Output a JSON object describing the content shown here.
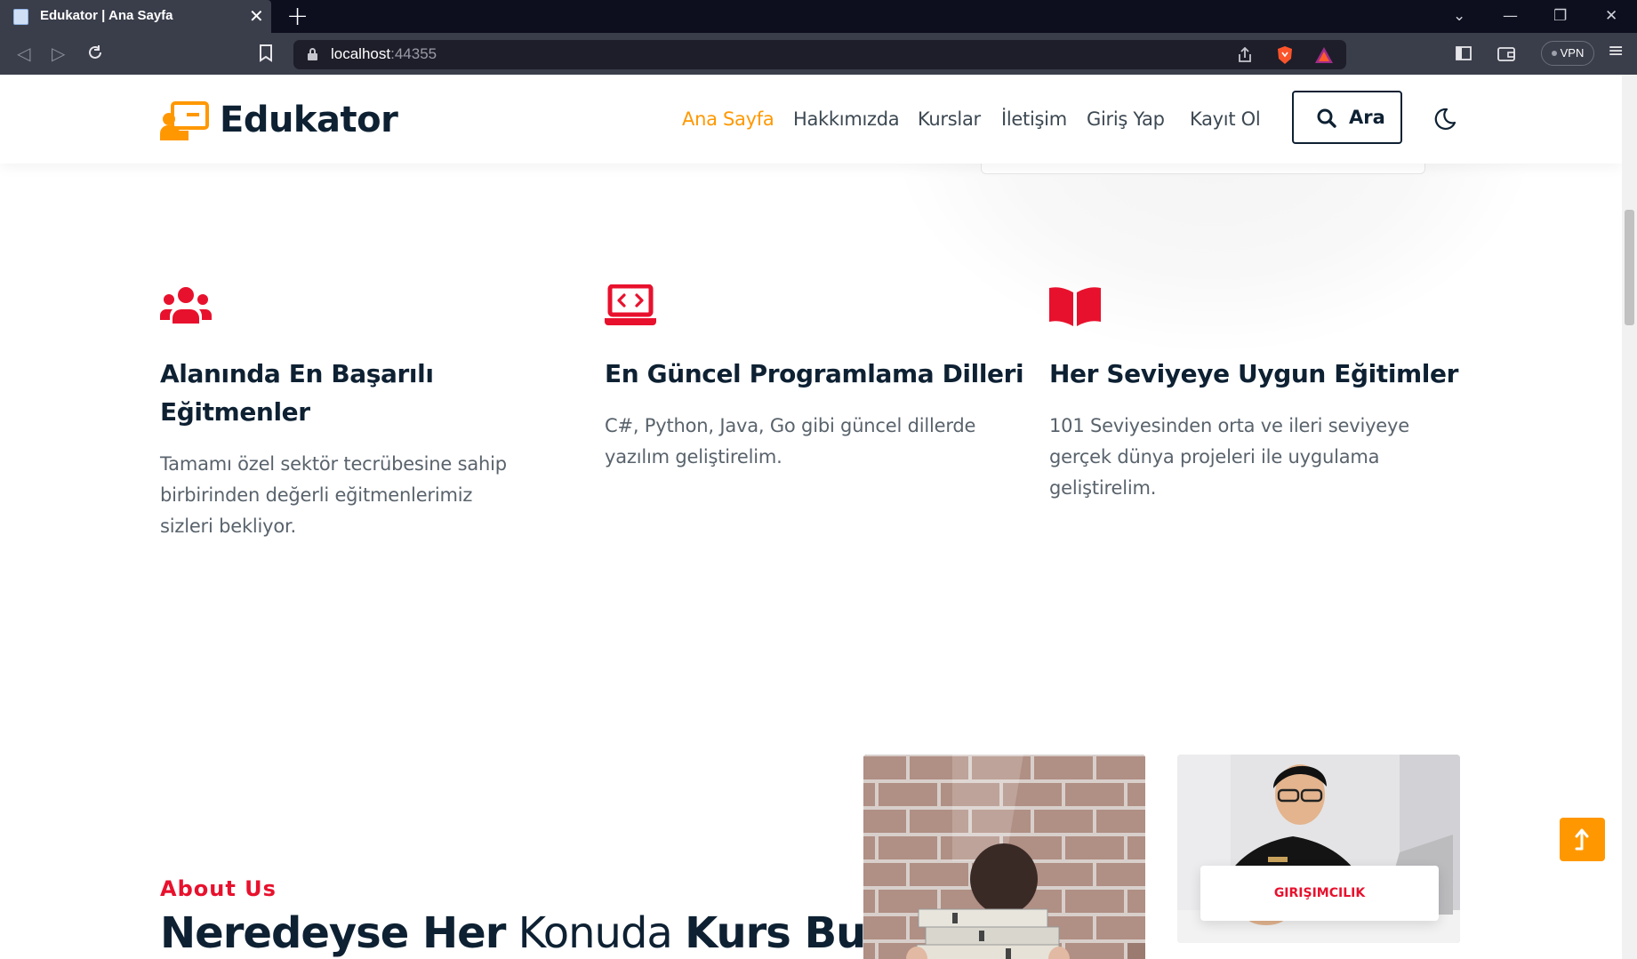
{
  "browser": {
    "tab_title": "Edukator | Ana Sayfa",
    "tab_close": "✕",
    "new_tab": "+",
    "url_host": "localhost",
    "url_port": ":44355",
    "vpn_label": "VPN",
    "window_controls": [
      "chevron-down",
      "minimize",
      "restore",
      "close"
    ]
  },
  "header": {
    "logo_text": "Edukator",
    "nav": [
      "Ana Sayfa",
      "Hakkımızda",
      "Kurslar",
      "İletişim",
      "Giriş Yap",
      "Kayıt Ol"
    ],
    "active_nav": "Ana Sayfa",
    "search_label": "Ara"
  },
  "features": [
    {
      "icon": "users-icon",
      "title": "Alanında En Başarılı Eğitmenler",
      "text": "Tamamı özel sektör tecrübesine sahip birbirinden değerli eğitmenlerimiz sizleri bekliyor."
    },
    {
      "icon": "laptop-code-icon",
      "title": "En Güncel Programlama Dilleri",
      "text": "C#, Python, Java, Go gibi güncel dillerde yazılım geliştirelim."
    },
    {
      "icon": "book-open-icon",
      "title": "Her Seviyeye Uygun Eğitimler",
      "text": "101 Seviyesinden orta ve ileri seviyeye gerçek dünya projeleri ile uygulama geliştirelim."
    }
  ],
  "about": {
    "tag": "About Us",
    "title_part1": "Neredeyse Her",
    "title_part2": "Konuda",
    "title_part3": "Kurs Bul"
  },
  "category_badge": "GIRIŞIMCILIK",
  "colors": {
    "accent": "#ff9800",
    "red": "#e8112d",
    "dark": "#0e2133"
  }
}
